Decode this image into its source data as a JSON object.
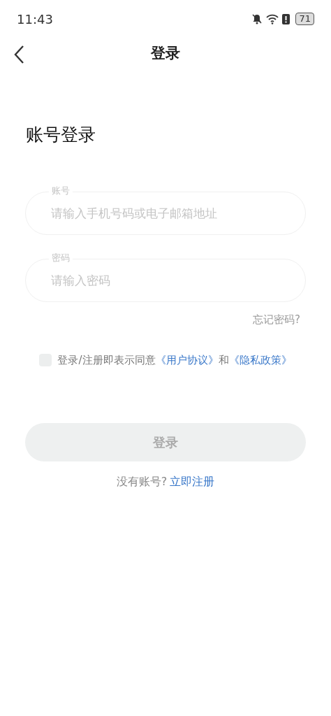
{
  "status_bar": {
    "time": "11:43",
    "battery": "71"
  },
  "header": {
    "title": "登录"
  },
  "heading": "账号登录",
  "fields": [
    {
      "label": "账号",
      "placeholder": "请输入手机号码或电子邮箱地址"
    },
    {
      "label": "密码",
      "placeholder": "请输入密码"
    }
  ],
  "forgot_link": "忘记密码?",
  "agreement": {
    "checked": false,
    "text": "登录/注册即表示同意",
    "links": [
      "《用户协议》",
      "《隐私政策》"
    ],
    "joiner": "和"
  },
  "login_button": {
    "label": "登录",
    "disabled": true
  },
  "register": {
    "prompt": "没有账号?",
    "link": "立即注册"
  }
}
